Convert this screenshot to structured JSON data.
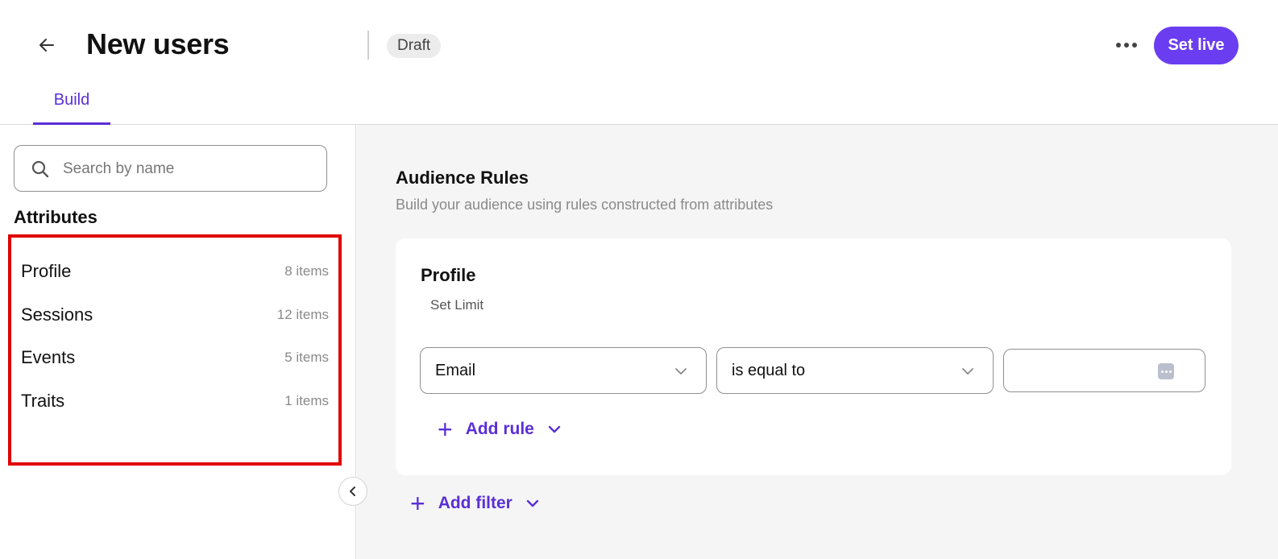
{
  "header": {
    "title": "New users",
    "status": "Draft",
    "primary_action": "Set live",
    "tabs": [
      {
        "label": "Build",
        "active": true
      }
    ]
  },
  "sidebar": {
    "search": {
      "placeholder": "Search by name",
      "value": ""
    },
    "section_title": "Attributes",
    "items": [
      {
        "label": "Profile",
        "count": "8 items"
      },
      {
        "label": "Sessions",
        "count": "12 items"
      },
      {
        "label": "Events",
        "count": "5 items"
      },
      {
        "label": "Traits",
        "count": "1 items"
      }
    ]
  },
  "main": {
    "title": "Audience Rules",
    "subtitle": "Build your audience using rules constructed from attributes",
    "card": {
      "title": "Profile",
      "set_limit_label": "Set Limit",
      "rule": {
        "attribute": "Email",
        "operator": "is equal to",
        "value": ""
      },
      "add_rule_label": "Add rule"
    },
    "add_filter_label": "Add filter"
  },
  "colors": {
    "accent": "#5a2fd6",
    "primary_button": "#6a3ef0",
    "highlight_border": "#e00000"
  }
}
